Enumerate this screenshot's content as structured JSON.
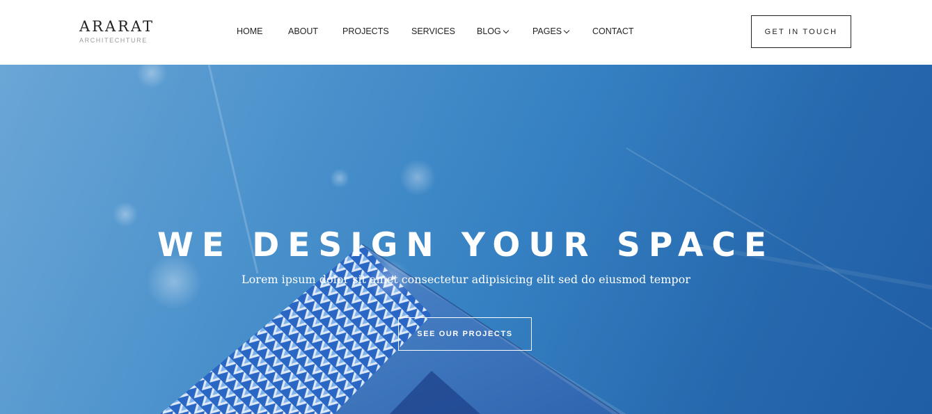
{
  "brand": {
    "name": "ARARAT",
    "tagline": "ARCHITECHTURE"
  },
  "nav": {
    "items": [
      {
        "label": "HOME"
      },
      {
        "label": "ABOUT"
      },
      {
        "label": "PROJECTS"
      },
      {
        "label": "SERVICES"
      },
      {
        "label": "BLOG",
        "icon": "chevron-down-icon"
      },
      {
        "label": "PAGES",
        "icon": "chevron-down-icon"
      },
      {
        "label": "CONTACT"
      }
    ],
    "cta_label": "GET IN TOUCH"
  },
  "hero": {
    "title": "WE DESIGN YOUR SPACE",
    "subtitle": "Lorem ipsum dolor sit amet consectetur adipisicing elit sed do eiusmod tempor",
    "button_label": "SEE OUR PROJECTS"
  },
  "colors": {
    "sky_light": "#6ba6d6",
    "sky_dark": "#1f5da5",
    "text_dark": "#222222",
    "white": "#ffffff"
  }
}
